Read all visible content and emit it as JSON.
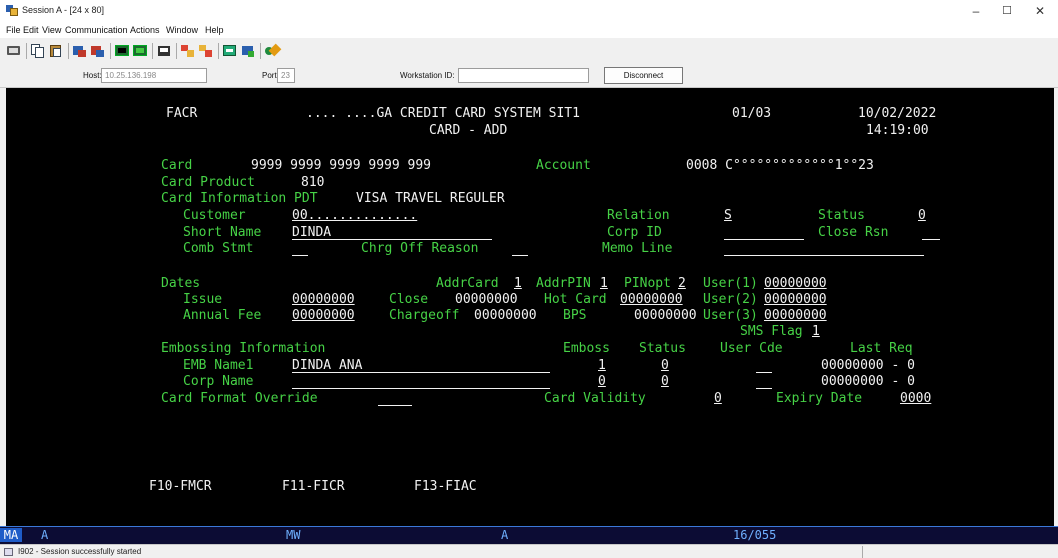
{
  "window": {
    "title": "Session A - [24 x 80]",
    "controls": {
      "minimize": "–",
      "maximize": "☐",
      "close": "✕"
    }
  },
  "menu": [
    "File",
    "Edit",
    "View",
    "Communication",
    "Actions",
    "Window",
    "Help"
  ],
  "toolbar_icons": [
    "print-screen-icon",
    "copy-icon",
    "paste-icon",
    "send-icon",
    "receive-icon",
    "display-icon",
    "keypad-icon",
    "record-icon",
    "playback-icon",
    "macro-icon",
    "customize-icon",
    "color-icon",
    "help-icon"
  ],
  "hostbar": {
    "host_label": "Host:",
    "host_value": "10.25.136.198",
    "port_label": "Port:",
    "port_value": "23",
    "workstation_label": "Workstation ID:",
    "workstation_value": "",
    "disconnect": "Disconnect"
  },
  "screen": {
    "code": "FACR",
    "system_title": ".... ....GA CREDIT CARD SYSTEM SIT1",
    "page": "01/03",
    "date": "10/02/2022",
    "subtitle": "CARD - ADD",
    "time": "14:19:00",
    "card_label": "Card",
    "card_value": "9999 9999 9999 9999 999",
    "account_label": "Account",
    "account_value": "0008 C°°°°°°°°°°°°°1°°23",
    "product_label": "Card Product",
    "product_value": "810",
    "info_label": "Card Information PDT",
    "info_value": "VISA TRAVEL REGULER",
    "customer_label": "Customer",
    "customer_value": "00..............",
    "relation_label": "Relation",
    "relation_value": "S",
    "status_label": "Status",
    "status_value": "0",
    "short_name_label": "Short Name",
    "short_name_value": "DINDA",
    "corp_id_label": "Corp ID",
    "close_rsn_label": "Close Rsn",
    "comb_stmt_label": "Comb Stmt",
    "chrg_off_label": "Chrg Off Reason",
    "memo_label": "Memo Line",
    "dates_label": "Dates",
    "addrcard_label": "AddrCard",
    "addrcard_value": "1",
    "addrpin_label": "AddrPIN",
    "addrpin_value": "1",
    "pinopt_label": "PINopt",
    "pinopt_value": "2",
    "user1_label": "User(1)",
    "user1_value": "00000000",
    "issue_label": "Issue",
    "issue_value": "00000000",
    "close_label": "Close",
    "close_value": "00000000",
    "hot_card_label": "Hot Card",
    "hot_card_value": "00000000",
    "user2_label": "User(2)",
    "user2_value": "00000000",
    "annual_fee_label": "Annual Fee",
    "annual_fee_value": "00000000",
    "chargeoff_label": "Chargeoff",
    "chargeoff_value": "00000000",
    "bps_label": "BPS",
    "bps_value": "00000000",
    "user3_label": "User(3)",
    "user3_value": "00000000",
    "sms_flag_label": "SMS Flag",
    "sms_flag_value": "1",
    "embossing_label": "Embossing Information",
    "emboss_col": "Emboss",
    "status_col": "Status",
    "user_cde_col": "User Cde",
    "last_req_col": "Last Req",
    "emb_name_label": "EMB Name1",
    "emb_name_value": "DINDA ANA",
    "emb_emboss_value": "1",
    "emb_status_value": "0",
    "emb_last_req": "00000000 - 0",
    "corp_name_label": "Corp Name",
    "corp_emboss_value": "0",
    "corp_status_value": "0",
    "corp_last_req": "00000000 - 0",
    "format_override_label": "Card Format Override",
    "validity_label": "Card Validity",
    "validity_value": "0",
    "expiry_label": "Expiry Date",
    "expiry_value": "0000",
    "pf_keys": [
      "F10-FMCR",
      "F11-FICR",
      "F13-FIAC"
    ]
  },
  "oia": {
    "mb": "MA",
    "indicator_a": "A",
    "mw": "MW",
    "indicator_b": "A",
    "cursor": "16/055"
  },
  "statusbar": {
    "message": "I902 - Session successfully started"
  }
}
